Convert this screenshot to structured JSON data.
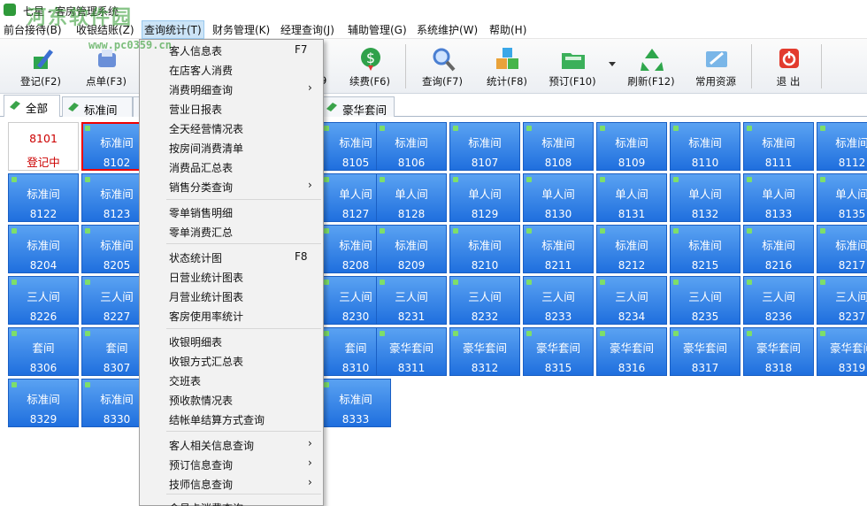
{
  "titlebar": {
    "title": "七星 - 客房管理系统"
  },
  "watermark": {
    "text": "河东软件园",
    "url": "www.pc0359.cn"
  },
  "menubar": {
    "items": [
      {
        "label": "前台接待(B)"
      },
      {
        "label": "收银结账(Z)"
      },
      {
        "label": "查询统计(T)"
      },
      {
        "label": "财务管理(K)"
      },
      {
        "label": "经理查询(J)"
      },
      {
        "label": "辅助管理(G)"
      },
      {
        "label": "系统维护(W)"
      },
      {
        "label": "帮助(H)"
      }
    ]
  },
  "toolbar": {
    "buttons": [
      {
        "label": "登记(F2)",
        "icon": "register-pen-icon"
      },
      {
        "label": "点单(F3)",
        "icon": "order-icon"
      },
      {
        "label": "续费(F6)",
        "icon": "renew-dollar-icon"
      },
      {
        "label": "查询(F7)",
        "icon": "query-magnifier-icon"
      },
      {
        "label": "统计(F8)",
        "icon": "statistics-cubes-icon"
      },
      {
        "label": "预订(F10)",
        "icon": "reserve-folder-icon"
      },
      {
        "label": "刷新(F12)",
        "icon": "refresh-recycle-icon"
      },
      {
        "label": "常用资源",
        "icon": "resources-icon"
      },
      {
        "label": "退  出",
        "icon": "exit-power-icon"
      }
    ],
    "partial_label": "9"
  },
  "tabs": [
    {
      "label": "全部"
    },
    {
      "label": "标准间"
    },
    {
      "label": "豪华套间"
    }
  ],
  "rooms": [
    {
      "type": "8101",
      "number": "登记中",
      "state": "registering"
    },
    {
      "type": "标准间",
      "number": "8102",
      "state": "vacant"
    },
    {
      "type": "标准间",
      "number": "8105",
      "state": "vacant"
    },
    {
      "type": "标准间",
      "number": "8106",
      "state": "vacant"
    },
    {
      "type": "标准间",
      "number": "8107",
      "state": "vacant"
    },
    {
      "type": "标准间",
      "number": "8108",
      "state": "vacant"
    },
    {
      "type": "标准间",
      "number": "8109",
      "state": "vacant"
    },
    {
      "type": "标准间",
      "number": "8110",
      "state": "vacant"
    },
    {
      "type": "标准间",
      "number": "8111",
      "state": "vacant"
    },
    {
      "type": "标准间",
      "number": "8112",
      "state": "vacant"
    },
    {
      "type": "标准间",
      "number": "8122",
      "state": "vacant"
    },
    {
      "type": "标准间",
      "number": "8123",
      "state": "vacant"
    },
    {
      "type": "单人间",
      "number": "8127",
      "state": "vacant"
    },
    {
      "type": "单人间",
      "number": "8128",
      "state": "vacant"
    },
    {
      "type": "单人间",
      "number": "8129",
      "state": "vacant"
    },
    {
      "type": "单人间",
      "number": "8130",
      "state": "vacant"
    },
    {
      "type": "单人间",
      "number": "8131",
      "state": "vacant"
    },
    {
      "type": "单人间",
      "number": "8132",
      "state": "vacant"
    },
    {
      "type": "单人间",
      "number": "8133",
      "state": "vacant"
    },
    {
      "type": "单人间",
      "number": "8135",
      "state": "vacant"
    },
    {
      "type": "标准间",
      "number": "8204",
      "state": "vacant"
    },
    {
      "type": "标准间",
      "number": "8205",
      "state": "vacant"
    },
    {
      "type": "标准间",
      "number": "8208",
      "state": "vacant"
    },
    {
      "type": "标准间",
      "number": "8209",
      "state": "vacant"
    },
    {
      "type": "标准间",
      "number": "8210",
      "state": "vacant"
    },
    {
      "type": "标准间",
      "number": "8211",
      "state": "vacant"
    },
    {
      "type": "标准间",
      "number": "8212",
      "state": "vacant"
    },
    {
      "type": "标准间",
      "number": "8215",
      "state": "vacant"
    },
    {
      "type": "标准间",
      "number": "8216",
      "state": "vacant"
    },
    {
      "type": "标准间",
      "number": "8217",
      "state": "vacant"
    },
    {
      "type": "三人间",
      "number": "8226",
      "state": "vacant"
    },
    {
      "type": "三人间",
      "number": "8227",
      "state": "vacant"
    },
    {
      "type": "三人间",
      "number": "8230",
      "state": "vacant"
    },
    {
      "type": "三人间",
      "number": "8231",
      "state": "vacant"
    },
    {
      "type": "三人间",
      "number": "8232",
      "state": "vacant"
    },
    {
      "type": "三人间",
      "number": "8233",
      "state": "vacant"
    },
    {
      "type": "三人间",
      "number": "8234",
      "state": "vacant"
    },
    {
      "type": "三人间",
      "number": "8235",
      "state": "vacant"
    },
    {
      "type": "三人间",
      "number": "8236",
      "state": "vacant"
    },
    {
      "type": "三人间",
      "number": "8237",
      "state": "vacant"
    },
    {
      "type": "套间",
      "number": "8306",
      "state": "vacant"
    },
    {
      "type": "套间",
      "number": "8307",
      "state": "vacant"
    },
    {
      "type": "套间",
      "number": "8310",
      "state": "vacant"
    },
    {
      "type": "豪华套间",
      "number": "8311",
      "state": "vacant"
    },
    {
      "type": "豪华套间",
      "number": "8312",
      "state": "vacant"
    },
    {
      "type": "豪华套间",
      "number": "8315",
      "state": "vacant"
    },
    {
      "type": "豪华套间",
      "number": "8316",
      "state": "vacant"
    },
    {
      "type": "豪华套间",
      "number": "8317",
      "state": "vacant"
    },
    {
      "type": "豪华套间",
      "number": "8318",
      "state": "vacant"
    },
    {
      "type": "豪华套间",
      "number": "8319",
      "state": "vacant"
    },
    {
      "type": "标准间",
      "number": "8329",
      "state": "vacant"
    },
    {
      "type": "标准间",
      "number": "8330",
      "state": "vacant"
    },
    {
      "type": "标准间",
      "number": "8333",
      "state": "vacant"
    }
  ],
  "dropdown": {
    "items": [
      {
        "label": "客人信息表",
        "shortcut": "F7"
      },
      {
        "label": "在店客人消费"
      },
      {
        "label": "消费明细查询",
        "submenu": "›"
      },
      {
        "label": "营业日报表"
      },
      {
        "label": "全天经营情况表"
      },
      {
        "label": "按房间消费清单"
      },
      {
        "label": "消费品汇总表"
      },
      {
        "label": "销售分类查询",
        "submenu": "›"
      },
      {
        "label": "零单销售明细"
      },
      {
        "label": "零单消费汇总"
      },
      {
        "label": "状态统计图",
        "shortcut": "F8"
      },
      {
        "label": "日营业统计图表"
      },
      {
        "label": "月营业统计图表"
      },
      {
        "label": "客房使用率统计"
      },
      {
        "label": "收银明细表"
      },
      {
        "label": "收银方式汇总表"
      },
      {
        "label": "交班表"
      },
      {
        "label": "预收款情况表"
      },
      {
        "label": "结帐单结算方式查询"
      },
      {
        "label": "客人相关信息查询",
        "submenu": "›"
      },
      {
        "label": "预订信息查询",
        "submenu": "›"
      },
      {
        "label": "技师信息查询",
        "submenu": "›"
      },
      {
        "label": "会员卡消费查询"
      }
    ]
  },
  "colors": {
    "room_blue": "#2f7fe6",
    "registering_text": "#cc0000",
    "menu_bg": "#f2f2f2"
  }
}
